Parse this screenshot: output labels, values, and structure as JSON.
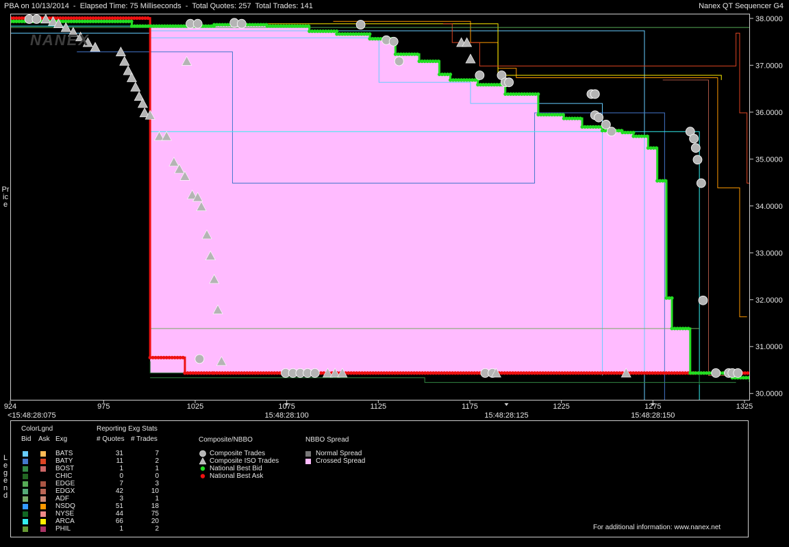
{
  "header": {
    "left": "PBA on 10/13/2014  -  Elapsed Time: 75 Milliseconds  -  Total Quotes: 257  Total Trades: 141",
    "right": "Nanex QT Sequencer G4"
  },
  "watermark": "NANEX",
  "y_axis_label": "Price",
  "legend_side_label": "Legend",
  "chart_data": {
    "type": "line",
    "title": "PBA on 10/13/2014",
    "xlim": [
      924,
      1328
    ],
    "ylim": [
      29.85,
      38.1
    ],
    "x_ticks": [
      924,
      975,
      1025,
      1075,
      1125,
      1175,
      1225,
      1275,
      1325
    ],
    "y_ticks": [
      "38.0000",
      "37.0000",
      "36.0000",
      "35.0000",
      "34.0000",
      "33.0000",
      "32.0000",
      "31.0000",
      "30.0000"
    ],
    "time_labels": [
      {
        "x": 924,
        "label": "<15:48:28:075"
      },
      {
        "x": 1075,
        "label": "15:48:28:100"
      },
      {
        "x": 1195,
        "label": "15:48:28:125"
      },
      {
        "x": 1275,
        "label": "15:48:28:150"
      }
    ],
    "colors": {
      "crossed_spread": "#ffbbff",
      "national_best_bid": "#22dd22",
      "national_best_ask": "#ee1111",
      "trade_marker": "#b4b4b4",
      "grid": "#555555"
    },
    "national_best_bid_steps": [
      [
        924,
        37.95
      ],
      [
        990,
        37.85
      ],
      [
        1035,
        37.88
      ],
      [
        1064,
        37.85
      ],
      [
        1087,
        37.74
      ],
      [
        1102,
        37.68
      ],
      [
        1120,
        37.58
      ],
      [
        1134,
        37.25
      ],
      [
        1147,
        37.1
      ],
      [
        1158,
        36.82
      ],
      [
        1164,
        36.7
      ],
      [
        1179,
        36.6
      ],
      [
        1194,
        36.4
      ],
      [
        1212,
        35.96
      ],
      [
        1226,
        35.88
      ],
      [
        1236,
        35.7
      ],
      [
        1247,
        35.62
      ],
      [
        1258,
        35.58
      ],
      [
        1264,
        35.5
      ],
      [
        1272,
        35.25
      ],
      [
        1277,
        34.55
      ],
      [
        1282,
        32.05
      ],
      [
        1285,
        31.4
      ],
      [
        1295,
        30.45
      ],
      [
        1318,
        30.35
      ],
      [
        1328,
        30.28
      ]
    ],
    "national_best_ask_steps": [
      [
        924,
        38.02
      ],
      [
        1000,
        30.78
      ],
      [
        1019,
        30.45
      ],
      [
        1035,
        30.45
      ],
      [
        1298,
        30.45
      ],
      [
        1328,
        30.45
      ]
    ],
    "crossed_spread_region": [
      [
        1000,
        30.45,
        37.85
      ],
      [
        1035,
        30.45,
        37.88
      ],
      [
        1064,
        30.45,
        37.85
      ],
      [
        1087,
        30.45,
        37.74
      ],
      [
        1102,
        30.45,
        37.68
      ],
      [
        1120,
        30.45,
        37.58
      ],
      [
        1134,
        30.45,
        37.25
      ],
      [
        1147,
        30.45,
        37.1
      ],
      [
        1158,
        30.45,
        36.82
      ],
      [
        1164,
        30.45,
        36.7
      ],
      [
        1179,
        30.45,
        36.6
      ],
      [
        1194,
        30.45,
        36.4
      ],
      [
        1212,
        30.45,
        35.96
      ],
      [
        1226,
        30.45,
        35.88
      ],
      [
        1236,
        30.45,
        35.7
      ],
      [
        1247,
        30.45,
        35.62
      ],
      [
        1258,
        30.45,
        35.58
      ],
      [
        1264,
        30.45,
        35.5
      ],
      [
        1272,
        30.45,
        35.25
      ],
      [
        1277,
        30.45,
        34.55
      ],
      [
        1282,
        30.45,
        32.05
      ],
      [
        1285,
        30.45,
        31.4
      ],
      [
        1295,
        30.45,
        30.45
      ]
    ],
    "composite_trades": [
      [
        934,
        38.0
      ],
      [
        938,
        38.0
      ],
      [
        1022,
        37.9
      ],
      [
        1026,
        37.9
      ],
      [
        1046,
        37.92
      ],
      [
        1050,
        37.9
      ],
      [
        1115,
        37.88
      ],
      [
        1129,
        37.55
      ],
      [
        1133,
        37.52
      ],
      [
        1136,
        37.1
      ],
      [
        1180,
        36.8
      ],
      [
        1192,
        36.8
      ],
      [
        1194,
        36.65
      ],
      [
        1196,
        36.65
      ],
      [
        1241,
        36.4
      ],
      [
        1243,
        36.4
      ],
      [
        1243,
        35.95
      ],
      [
        1245,
        35.9
      ],
      [
        1249,
        35.75
      ],
      [
        1252,
        35.6
      ],
      [
        1295,
        35.6
      ],
      [
        1297,
        35.45
      ],
      [
        1298,
        35.25
      ],
      [
        1299,
        35.0
      ],
      [
        1301,
        34.5
      ],
      [
        1302,
        32.0
      ],
      [
        1309,
        30.45
      ],
      [
        1316,
        30.45
      ],
      [
        1318,
        30.45
      ],
      [
        1321,
        30.45
      ],
      [
        1074,
        30.45
      ],
      [
        1078,
        30.45
      ],
      [
        1082,
        30.45
      ],
      [
        1086,
        30.45
      ],
      [
        1090,
        30.45
      ],
      [
        1183,
        30.45
      ],
      [
        1187,
        30.45
      ],
      [
        1027,
        30.75
      ]
    ],
    "composite_iso_trades": [
      [
        943,
        38.0
      ],
      [
        947,
        37.95
      ],
      [
        950,
        37.9
      ],
      [
        954,
        37.82
      ],
      [
        958,
        37.72
      ],
      [
        962,
        37.62
      ],
      [
        966,
        37.5
      ],
      [
        970,
        37.4
      ],
      [
        984,
        37.3
      ],
      [
        986,
        37.1
      ],
      [
        988,
        36.9
      ],
      [
        990,
        36.75
      ],
      [
        992,
        36.55
      ],
      [
        994,
        36.35
      ],
      [
        996,
        36.2
      ],
      [
        997,
        36.0
      ],
      [
        1000,
        35.95
      ],
      [
        1005,
        35.5
      ],
      [
        1009,
        35.5
      ],
      [
        1013,
        34.95
      ],
      [
        1016,
        34.8
      ],
      [
        1019,
        34.65
      ],
      [
        1023,
        34.25
      ],
      [
        1026,
        34.2
      ],
      [
        1028,
        34.0
      ],
      [
        1031,
        33.4
      ],
      [
        1033,
        32.95
      ],
      [
        1035,
        32.45
      ],
      [
        1037,
        31.8
      ],
      [
        1039,
        30.7
      ],
      [
        1020,
        37.1
      ],
      [
        1170,
        37.5
      ],
      [
        1173,
        37.5
      ],
      [
        1175,
        37.15
      ],
      [
        1097,
        30.45
      ],
      [
        1101,
        30.45
      ],
      [
        1105,
        30.45
      ],
      [
        1189,
        30.45
      ],
      [
        1260,
        30.45
      ]
    ]
  },
  "legend": {
    "col_headers": {
      "colorlgnd": "ColorLgnd",
      "bid": "Bid",
      "ask": "Ask",
      "exg": "Exg",
      "reporting": "Reporting Exg Stats",
      "quotes": "# Quotes",
      "trades": "# Trades"
    },
    "exchanges": [
      {
        "name": "BATS",
        "quotes": "31",
        "trades": "7",
        "bid_color": "#66ccff",
        "ask_color": "#ffbb55"
      },
      {
        "name": "BATY",
        "quotes": "11",
        "trades": "2",
        "bid_color": "#4477cc",
        "ask_color": "#dd4422"
      },
      {
        "name": "BOST",
        "quotes": "1",
        "trades": "1",
        "bid_color": "#338844",
        "ask_color": "#cc6666"
      },
      {
        "name": "CHIC",
        "quotes": "0",
        "trades": "0",
        "bid_color": "#226622",
        "ask_color": "#000000"
      },
      {
        "name": "EDGE",
        "quotes": "7",
        "trades": "3",
        "bid_color": "#55aa55",
        "ask_color": "#aa5544"
      },
      {
        "name": "EDGX",
        "quotes": "42",
        "trades": "10",
        "bid_color": "#55aa77",
        "ask_color": "#bb6655"
      },
      {
        "name": "ADF",
        "quotes": "3",
        "trades": "1",
        "bid_color": "#77aa66",
        "ask_color": "#cc8877"
      },
      {
        "name": "NSDQ",
        "quotes": "51",
        "trades": "18",
        "bid_color": "#3399ff",
        "ask_color": "#ff9900"
      },
      {
        "name": "NYSE",
        "quotes": "44",
        "trades": "75",
        "bid_color": "#116622",
        "ask_color": "#ee8888"
      },
      {
        "name": "ARCA",
        "quotes": "66",
        "trades": "20",
        "bid_color": "#33eeee",
        "ask_color": "#ffee00"
      },
      {
        "name": "PHIL",
        "quotes": "1",
        "trades": "2",
        "bid_color": "#669933",
        "ask_color": "#aa3366"
      }
    ],
    "composite_title": "Composite/NBBO",
    "composite_items": [
      {
        "label": "Composite Trades",
        "icon": "circle",
        "color": "#b4b4b4"
      },
      {
        "label": "Composite ISO Trades",
        "icon": "triangle",
        "color": "#b4b4b4"
      },
      {
        "label": "National Best Bid",
        "icon": "dot",
        "color": "#22dd22"
      },
      {
        "label": "National Best Ask",
        "icon": "dot",
        "color": "#ee1111"
      }
    ],
    "spread_title": "NBBO Spread",
    "spread_items": [
      {
        "label": "Normal Spread",
        "color": "#777777"
      },
      {
        "label": "Crossed Spread",
        "color": "#ffbbff"
      }
    ],
    "footer": "For additional information: www.nanex.net"
  }
}
